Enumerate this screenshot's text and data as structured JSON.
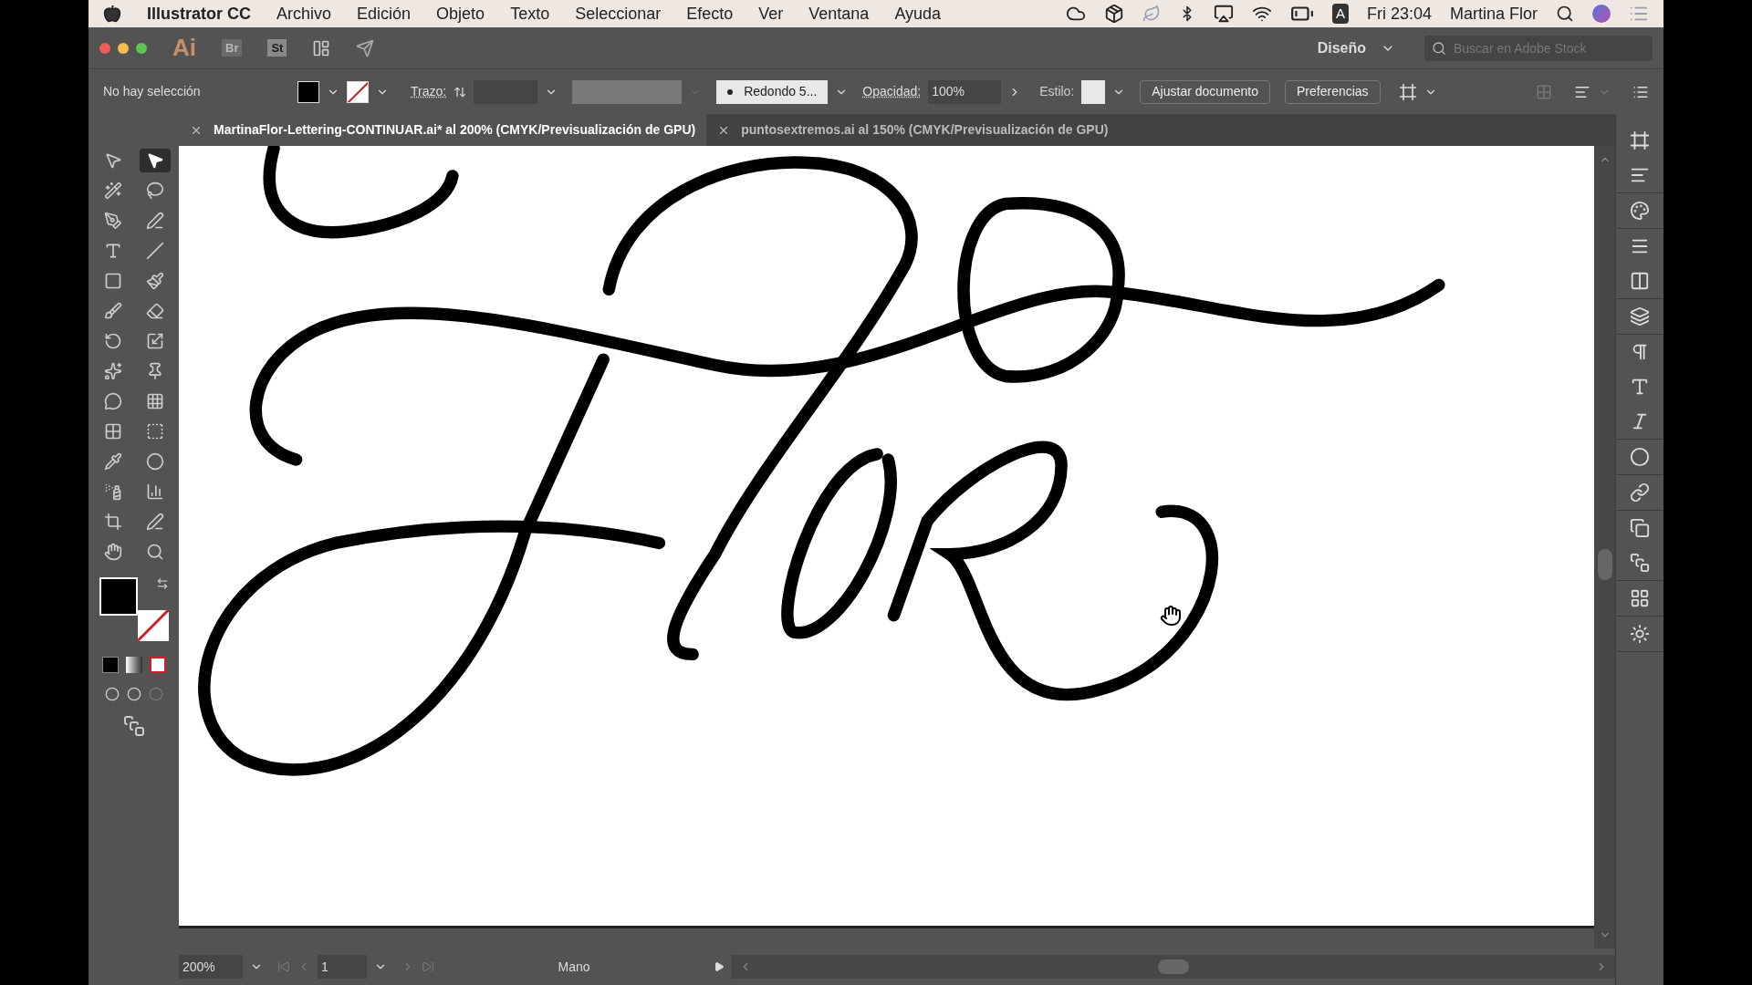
{
  "menu_bar": {
    "app_name": "Illustrator CC",
    "menus": [
      "Archivo",
      "Edición",
      "Objeto",
      "Texto",
      "Seleccionar",
      "Efecto",
      "Ver",
      "Ventana",
      "Ayuda"
    ],
    "input_source": "A",
    "clock": "Fri 23:04",
    "user": "Martina Flor"
  },
  "app_bar": {
    "badges": [
      {
        "label": "Ai",
        "kind": "main"
      },
      {
        "label": "Br",
        "kind": "dim"
      },
      {
        "label": "St",
        "kind": "plain"
      }
    ],
    "workspace": "Diseño",
    "search": {
      "placeholder": "Buscar en Adobe Stock"
    }
  },
  "control_bar": {
    "selection": "No hay selección",
    "stroke_label": "Trazo:",
    "brush": "Redondo 5...",
    "opacity_label": "Opacidad:",
    "opacity": "100%",
    "style_label": "Estilo:",
    "buttons": [
      "Ajustar documento",
      "Preferencias"
    ]
  },
  "tabs": [
    {
      "label": "MartinaFlor-Lettering-CONTINUAR.ai* al 200% (CMYK/Previsualización de GPU)",
      "selected": true
    },
    {
      "label": "puntosextremos.ai al 150% (CMYK/Previsualización de GPU)",
      "selected": false
    }
  ],
  "tools": [
    {
      "selected": false
    },
    {
      "selected": true
    },
    {
      "selected": false
    },
    {
      "selected": false
    },
    {
      "selected": false
    },
    {
      "selected": false
    },
    {
      "selected": false
    },
    {
      "selected": false
    },
    {
      "selected": false
    },
    {
      "selected": false
    },
    {
      "selected": false
    },
    {
      "selected": false
    },
    {
      "selected": false
    },
    {
      "selected": false
    },
    {
      "selected": false
    },
    {
      "selected": false
    },
    {
      "selected": false
    },
    {
      "selected": false
    },
    {
      "selected": false
    },
    {
      "selected": false
    },
    {
      "selected": false
    },
    {
      "selected": false
    },
    {
      "selected": false
    },
    {
      "selected": false
    },
    {
      "selected": false
    },
    {
      "selected": false
    }
  ],
  "status_bar": {
    "zoom": "200%",
    "artboard": "1",
    "tool": "Mano"
  }
}
